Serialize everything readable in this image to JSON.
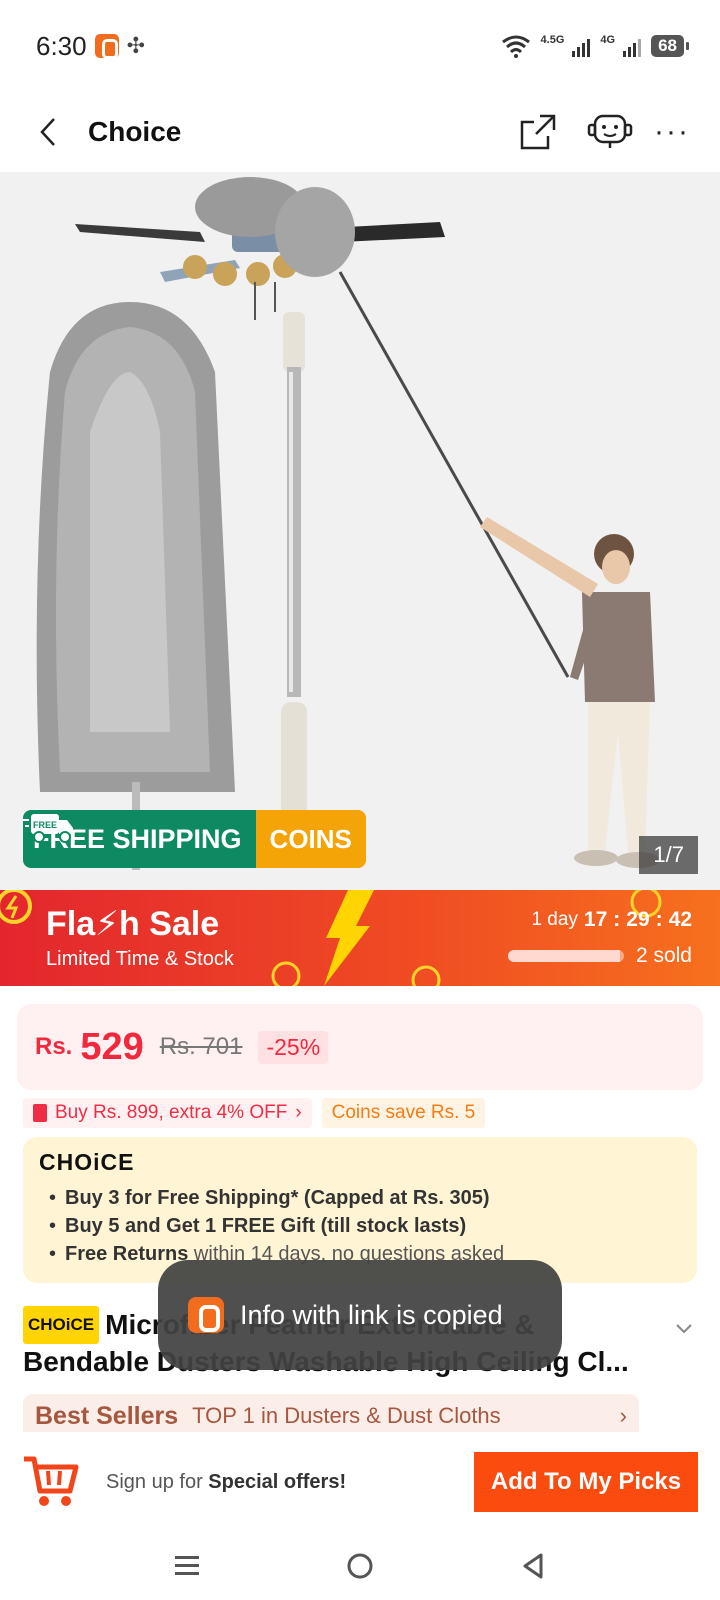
{
  "status": {
    "time": "6:30",
    "net1": "4.5G",
    "net2": "4G",
    "battery": "68"
  },
  "header": {
    "title": "Choice"
  },
  "hero": {
    "badge_shipping": "FREE SHIPPING",
    "badge_free": "FREE",
    "badge_coins": "COINS",
    "page_counter": "1/7"
  },
  "flash": {
    "title": "Fla⚡h Sale",
    "subtitle": "Limited Time & Stock",
    "days": "1 day",
    "hours": "17",
    "minutes": "29",
    "seconds": "42",
    "sold": "2 sold",
    "sold_progress": 0.97
  },
  "price": {
    "currency": "Rs.",
    "value": "529",
    "original": "Rs. 701",
    "discount": "-25%"
  },
  "promos": {
    "buy_offer": "Buy Rs. 899, extra 4% OFF",
    "coins_save": "Coins save Rs. 5"
  },
  "choice": {
    "logo": "CHOiCE",
    "items": [
      {
        "bold": "Buy 3 for  Free Shipping* (Capped at Rs. 305)",
        "rest": ""
      },
      {
        "bold": "Buy 5 and Get 1 FREE Gift (till stock lasts)",
        "rest": ""
      },
      {
        "bold": "Free Returns",
        "rest": " within 14 days, no questions asked"
      }
    ]
  },
  "product": {
    "tag": "CHOiCE",
    "title": "Microfiber Feather Extendable & Bendable Dusters Washable High Ceiling Cl..."
  },
  "best_sellers": {
    "title": "Best Sellers",
    "text": "TOP 1 in Dusters & Dust Cloths"
  },
  "toast": {
    "text": "Info with link is copied"
  },
  "bottom": {
    "signup_prefix": "Sign up for ",
    "signup_bold": "Special offers!",
    "button": "Add To My Picks"
  },
  "colors": {
    "accent": "#fb4b0e",
    "price": "#f3283d",
    "shipping": "#0e8a63",
    "coins": "#f5a408"
  }
}
